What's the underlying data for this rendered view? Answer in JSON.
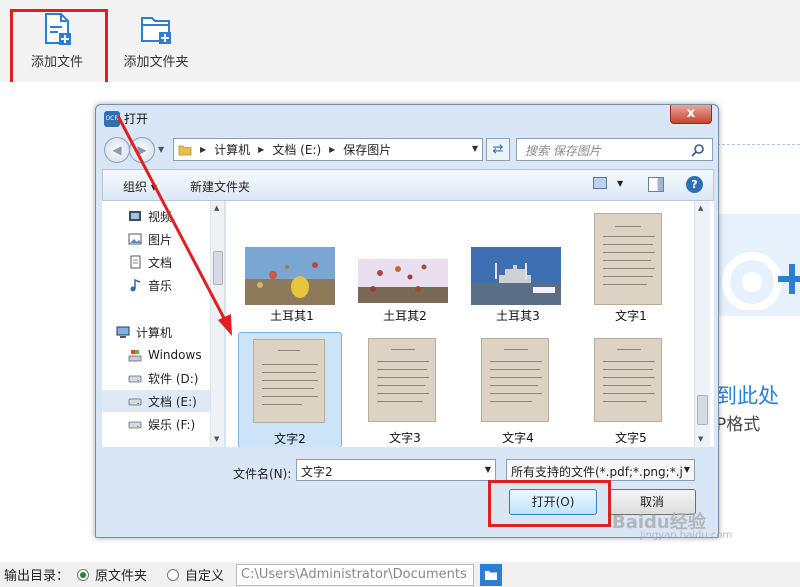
{
  "toolbar": {
    "add_file_label": "添加文件",
    "add_folder_label": "添加文件夹"
  },
  "drop_zone": {
    "title": "到此处",
    "subtitle": "P格式"
  },
  "bottom_bar": {
    "output_label": "输出目录：",
    "option_source": "原文件夹",
    "option_custom": "自定义",
    "path_value": "C:\\Users\\Administrator\\Documents",
    "selected_option": "原文件夹"
  },
  "dialog": {
    "title": "打开",
    "close_glyph": "x",
    "address": [
      "计算机",
      "文档 (E:)",
      "保存图片"
    ],
    "search_placeholder": "搜索 保存图片",
    "organize_label": "组织 ▾",
    "new_folder_label": "新建文件夹",
    "nav_items": [
      {
        "label": "视频",
        "icon": "video-icon"
      },
      {
        "label": "图片",
        "icon": "pictures-icon"
      },
      {
        "label": "文档",
        "icon": "documents-icon"
      },
      {
        "label": "音乐",
        "icon": "music-icon"
      },
      {
        "label": "计算机",
        "icon": "computer-icon"
      },
      {
        "label": "Windows",
        "icon": "windows-drive-icon"
      },
      {
        "label": "软件 (D:)",
        "icon": "drive-icon"
      },
      {
        "label": "文档 (E:)",
        "icon": "drive-icon",
        "selected": true
      },
      {
        "label": "娱乐 (F:)",
        "icon": "drive-icon"
      }
    ],
    "files": [
      {
        "label": "土耳其1",
        "kind": "balloon-photo"
      },
      {
        "label": "土耳其2",
        "kind": "balloon-photo"
      },
      {
        "label": "土耳其3",
        "kind": "city-photo"
      },
      {
        "label": "文字1",
        "kind": "document-photo"
      },
      {
        "label": "文字2",
        "kind": "document-photo",
        "selected": true
      },
      {
        "label": "文字3",
        "kind": "document-photo"
      },
      {
        "label": "文字4",
        "kind": "document-photo"
      },
      {
        "label": "文字5",
        "kind": "document-photo"
      }
    ],
    "filename_label": "文件名(N):",
    "filename_value": "文字2",
    "filetype_value": "所有支持的文件(*.pdf;*.png;*.j",
    "open_label": "打开(O)",
    "cancel_label": "取消"
  },
  "watermark": {
    "text": "Baidu经验",
    "sub": "jingyan.baidu.com"
  },
  "colors": {
    "highlight": "#e02020",
    "accent": "#2a7fd4",
    "selection": "#cce4f7"
  }
}
